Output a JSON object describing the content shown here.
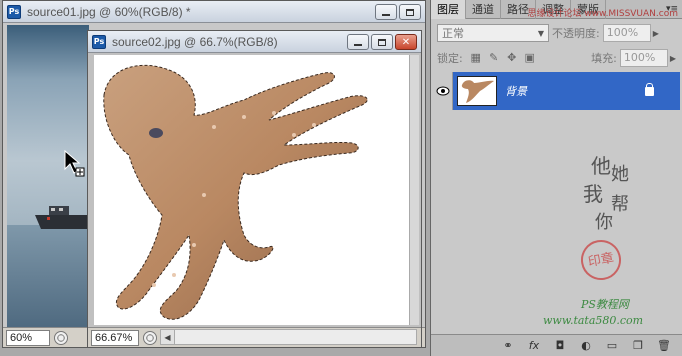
{
  "window1": {
    "title": "source01.jpg @ 60%(RGB/8) *",
    "zoom": "60%"
  },
  "window2": {
    "title": "source02.jpg @ 66.7%(RGB/8)",
    "zoom": "66.67%"
  },
  "titlebar_buttons": {
    "minimize": "",
    "maximize": "",
    "close": "✕"
  },
  "ps_icon": "Ps",
  "panel": {
    "tabs": [
      "图层",
      "通道",
      "路径",
      "调整",
      "蒙版"
    ],
    "watermark_top": "思缘设计论坛 www.MISSVUAN.com",
    "blend_mode": "正常",
    "opacity_label": "不透明度:",
    "opacity_value": "100%",
    "lock_label": "锁定:",
    "fill_label": "填充:",
    "fill_value": "100%",
    "layer": {
      "name": "背景"
    },
    "calligraphy": [
      "他",
      "我",
      "她",
      "帮",
      "你"
    ],
    "seal_text": "印章",
    "site_name": "PS教程网",
    "site_url": "www.tata580.com",
    "footer_icons": [
      "link-icon",
      "fx-icon",
      "mask-icon",
      "adjustment-icon",
      "folder-icon",
      "new-layer-icon",
      "trash-icon"
    ]
  }
}
